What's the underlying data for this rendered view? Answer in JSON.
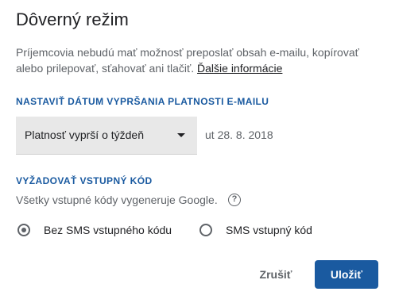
{
  "dialog": {
    "title": "Dôverný režim",
    "description": "Príjemcovia nebudú mať možnosť preposlať obsah e-mailu, kopírovať alebo prilepovať, sťahovať ani tlačiť.",
    "learn_more": "Ďalšie informácie"
  },
  "expiry": {
    "section_title": "NASTAVIŤ DÁTUM VYPRŠANIA PLATNOSTI E-MAILU",
    "selected_option": "Platnosť vyprší o týždeň",
    "date": "ut 28. 8. 2018"
  },
  "passcode": {
    "section_title": "VYŽADOVAŤ VSTUPNÝ KÓD",
    "description": "Všetky vstupné kódy vygeneruje Google.",
    "help_icon": "?",
    "options": [
      {
        "label": "Bez SMS vstupného kódu",
        "checked": true
      },
      {
        "label": "SMS vstupný kód",
        "checked": false
      }
    ]
  },
  "actions": {
    "cancel_label": "Zrušiť",
    "save_label": "Uložiť"
  },
  "colors": {
    "accent": "#1a5aa0",
    "select_bg": "#e8e8e8",
    "secondary_text": "#5f6368"
  }
}
